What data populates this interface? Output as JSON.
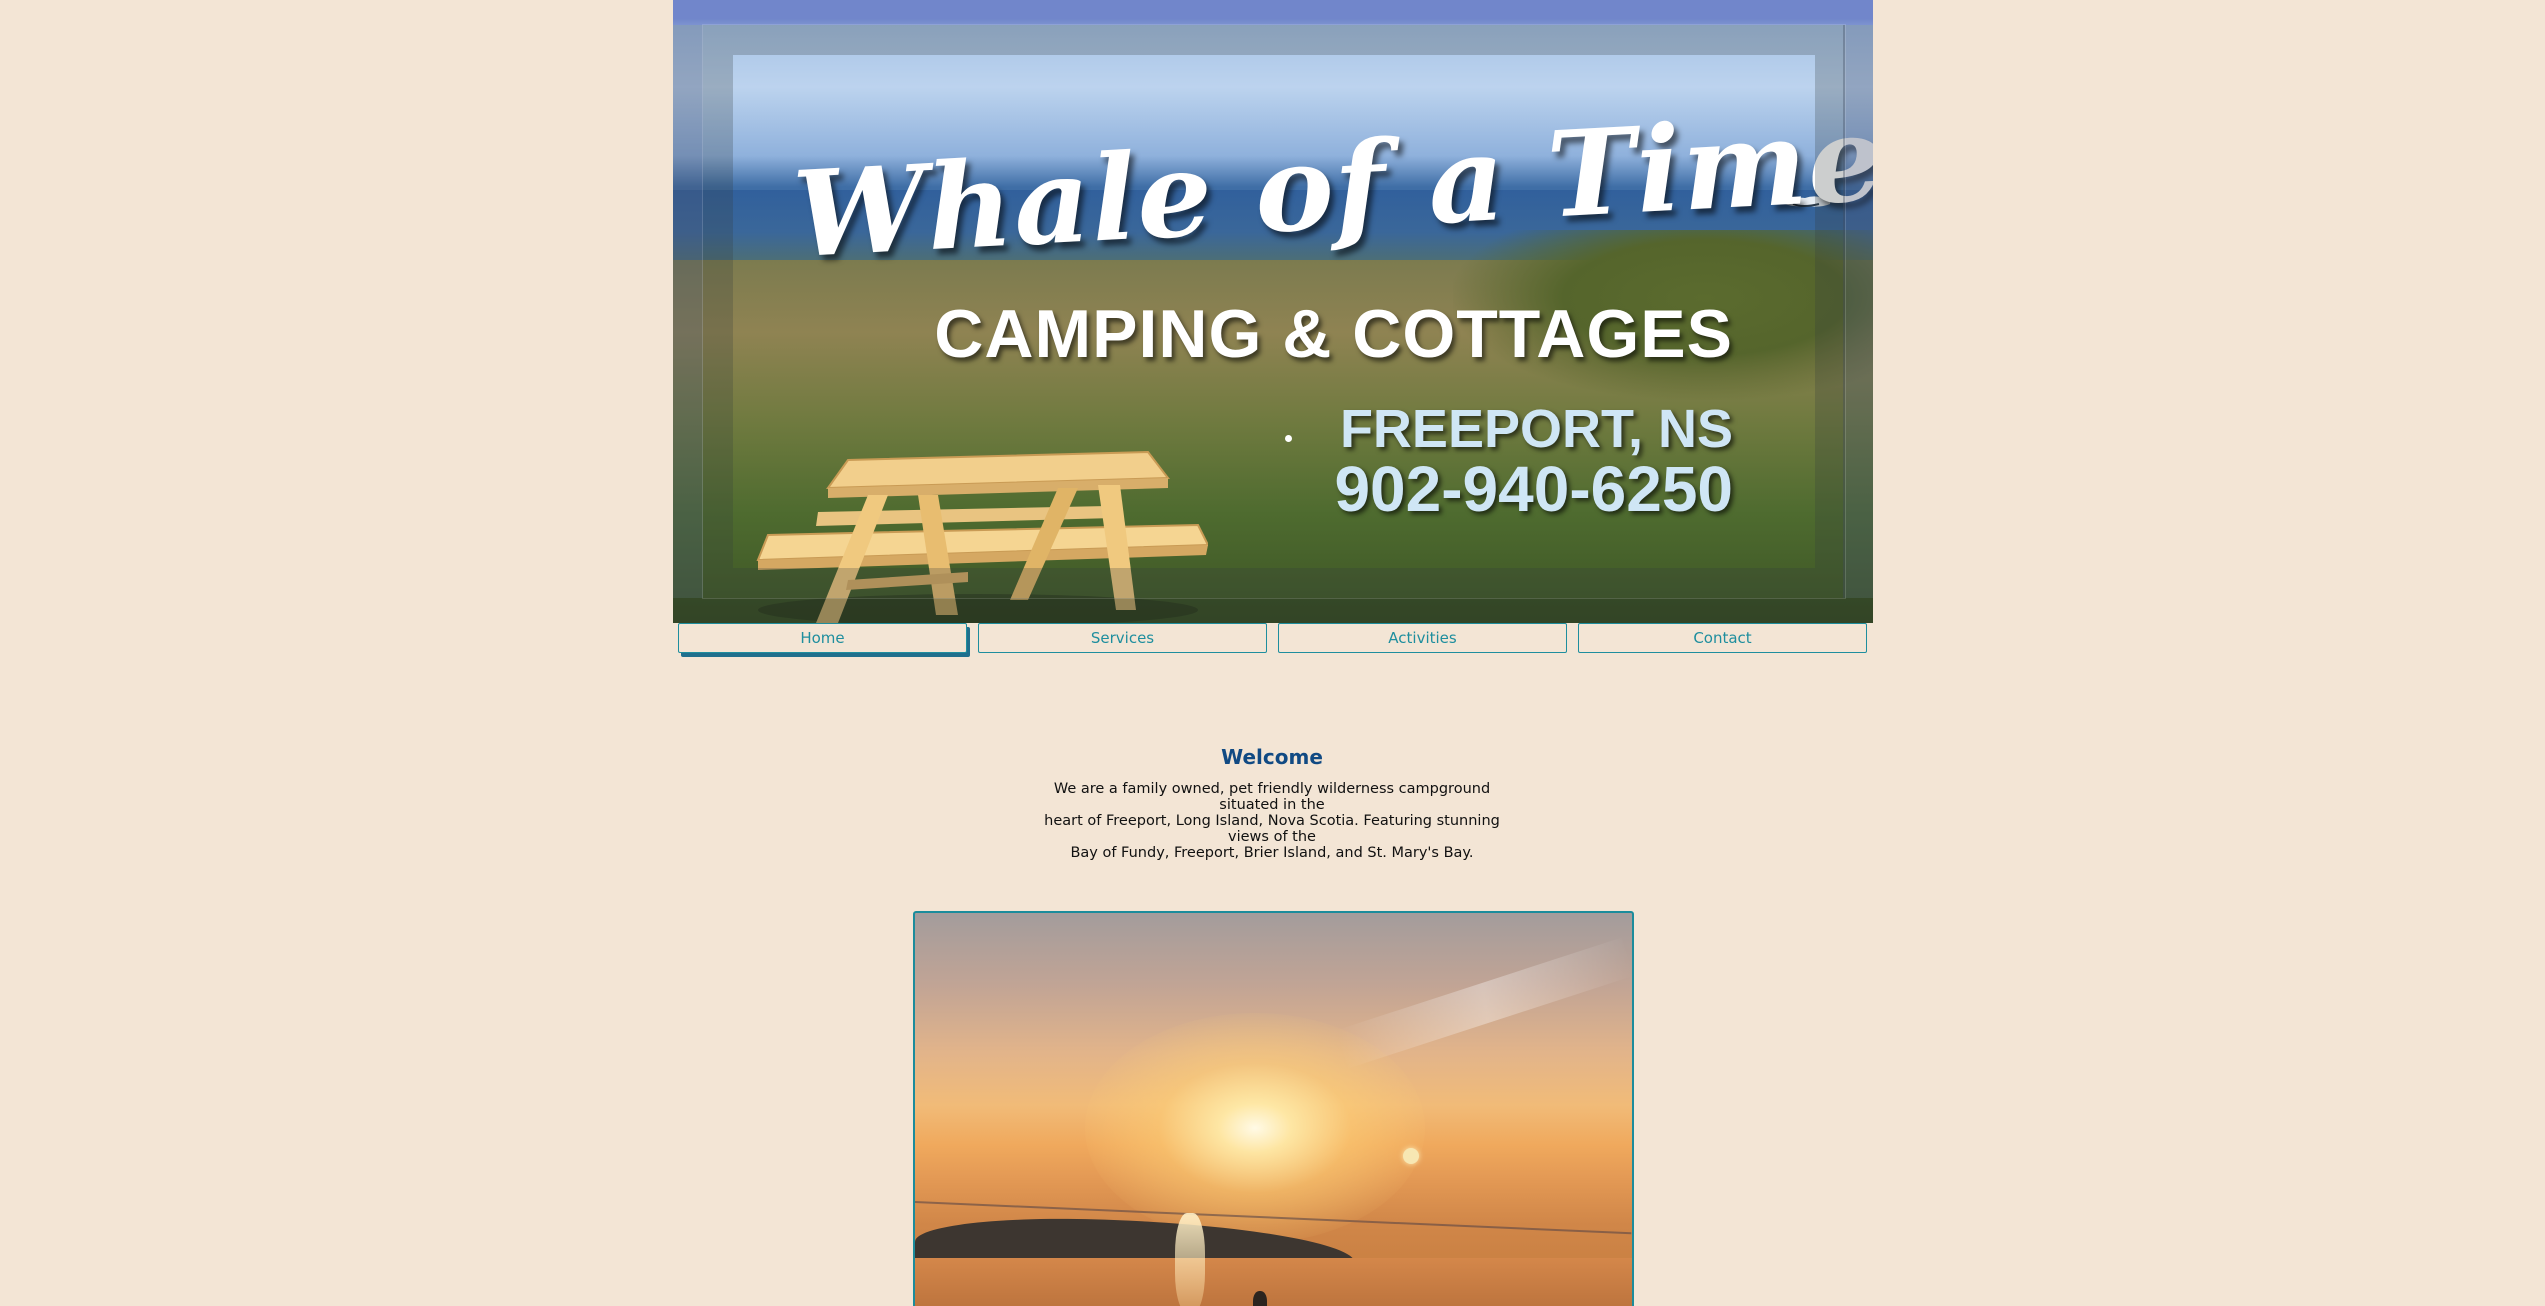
{
  "banner": {
    "title": "Whale of a Time",
    "subtitle": "CAMPING & COTTAGES",
    "location": "FREEPORT, NS",
    "phone": "902-940-6250"
  },
  "nav": {
    "items": [
      {
        "label": "Home",
        "active": true
      },
      {
        "label": "Services",
        "active": false
      },
      {
        "label": "Activities",
        "active": false
      },
      {
        "label": "Contact",
        "active": false
      }
    ]
  },
  "welcome": {
    "title": "Welcome",
    "text_line1": "We are a family owned, pet friendly wilderness campground situated in the",
    "text_line2": "heart of Freeport, Long Island, Nova Scotia. Featuring stunning views of the",
    "text_line3": "Bay of Fundy, Freeport, Brier Island, and St. Mary's Bay."
  },
  "colors": {
    "page_background": "#f3e5d5",
    "accent": "#1e8e9e",
    "heading": "#114a83"
  },
  "icons": {
    "whale": "whale-icon",
    "picnic_table": "picnic-table-icon"
  }
}
